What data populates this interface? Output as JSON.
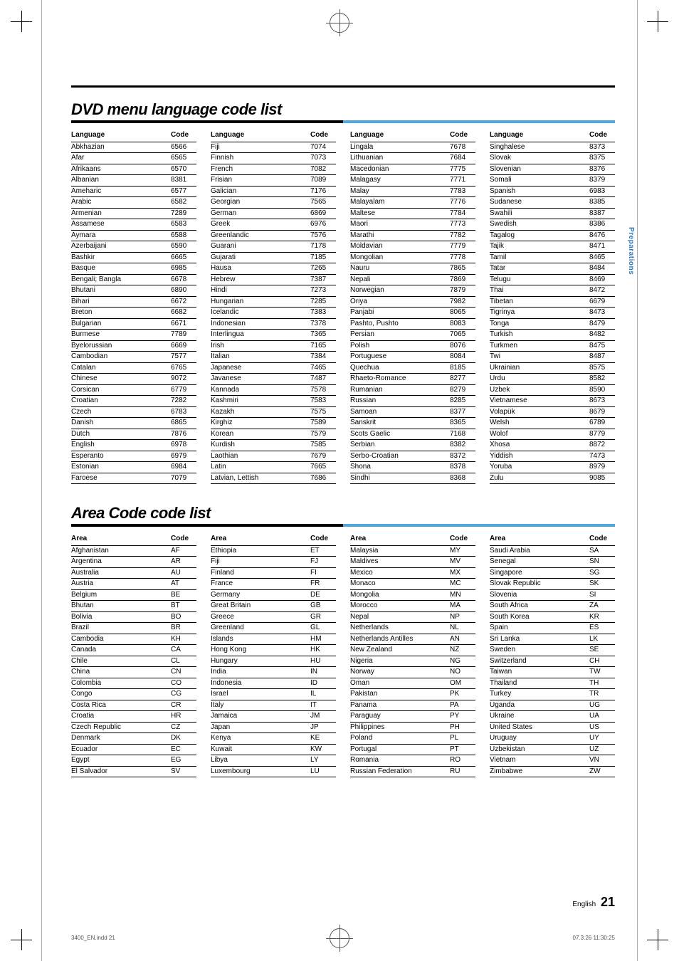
{
  "sideTab": "Preparations",
  "footer": {
    "lang": "English",
    "page": "21"
  },
  "printLeft": "3400_EN.indd   21",
  "printRight": "07.3.26   11:30:25",
  "section1": {
    "title": "DVD menu language code list",
    "headLabels": {
      "left": "Language",
      "right": "Code"
    },
    "cols": [
      [
        [
          "Abkhazian",
          "6566"
        ],
        [
          "Afar",
          "6565"
        ],
        [
          "Afrikaans",
          "6570"
        ],
        [
          "Albanian",
          "8381"
        ],
        [
          "Ameharic",
          "6577"
        ],
        [
          "Arabic",
          "6582"
        ],
        [
          "Armenian",
          "7289"
        ],
        [
          "Assamese",
          "6583"
        ],
        [
          "Aymara",
          "6588"
        ],
        [
          "Azerbaijani",
          "6590"
        ],
        [
          "Bashkir",
          "6665"
        ],
        [
          "Basque",
          "6985"
        ],
        [
          "Bengali; Bangla",
          "6678"
        ],
        [
          "Bhutani",
          "6890"
        ],
        [
          "Bihari",
          "6672"
        ],
        [
          "Breton",
          "6682"
        ],
        [
          "Bulgarian",
          "6671"
        ],
        [
          "Burmese",
          "7789"
        ],
        [
          "Byelorussian",
          "6669"
        ],
        [
          "Cambodian",
          "7577"
        ],
        [
          "Catalan",
          "6765"
        ],
        [
          "Chinese",
          "9072"
        ],
        [
          "Corsican",
          "6779"
        ],
        [
          "Croatian",
          "7282"
        ],
        [
          "Czech",
          "6783"
        ],
        [
          "Danish",
          "6865"
        ],
        [
          "Dutch",
          "7876"
        ],
        [
          "English",
          "6978"
        ],
        [
          "Esperanto",
          "6979"
        ],
        [
          "Estonian",
          "6984"
        ],
        [
          "Faroese",
          "7079"
        ]
      ],
      [
        [
          "Fiji",
          "7074"
        ],
        [
          "Finnish",
          "7073"
        ],
        [
          "French",
          "7082"
        ],
        [
          "Frisian",
          "7089"
        ],
        [
          "Galician",
          "7176"
        ],
        [
          "Georgian",
          "7565"
        ],
        [
          "German",
          "6869"
        ],
        [
          "Greek",
          "6976"
        ],
        [
          "Greenlandic",
          "7576"
        ],
        [
          "Guarani",
          "7178"
        ],
        [
          "Gujarati",
          "7185"
        ],
        [
          "Hausa",
          "7265"
        ],
        [
          "Hebrew",
          "7387"
        ],
        [
          "Hindi",
          "7273"
        ],
        [
          "Hungarian",
          "7285"
        ],
        [
          "Icelandic",
          "7383"
        ],
        [
          "Indonesian",
          "7378"
        ],
        [
          "Interlingua",
          "7365"
        ],
        [
          "Irish",
          "7165"
        ],
        [
          "Italian",
          "7384"
        ],
        [
          "Japanese",
          "7465"
        ],
        [
          "Javanese",
          "7487"
        ],
        [
          "Kannada",
          "7578"
        ],
        [
          "Kashmiri",
          "7583"
        ],
        [
          "Kazakh",
          "7575"
        ],
        [
          "Kirghiz",
          "7589"
        ],
        [
          "Korean",
          "7579"
        ],
        [
          "Kurdish",
          "7585"
        ],
        [
          "Laothian",
          "7679"
        ],
        [
          "Latin",
          "7665"
        ],
        [
          "Latvian, Lettish",
          "7686"
        ]
      ],
      [
        [
          "Lingala",
          "7678"
        ],
        [
          "Lithuanian",
          "7684"
        ],
        [
          "Macedonian",
          "7775"
        ],
        [
          "Malagasy",
          "7771"
        ],
        [
          "Malay",
          "7783"
        ],
        [
          "Malayalam",
          "7776"
        ],
        [
          "Maltese",
          "7784"
        ],
        [
          "Maori",
          "7773"
        ],
        [
          "Marathi",
          "7782"
        ],
        [
          "Moldavian",
          "7779"
        ],
        [
          "Mongolian",
          "7778"
        ],
        [
          "Nauru",
          "7865"
        ],
        [
          "Nepali",
          "7869"
        ],
        [
          "Norwegian",
          "7879"
        ],
        [
          "Oriya",
          "7982"
        ],
        [
          "Panjabi",
          "8065"
        ],
        [
          "Pashto, Pushto",
          "8083"
        ],
        [
          "Persian",
          "7065"
        ],
        [
          "Polish",
          "8076"
        ],
        [
          "Portuguese",
          "8084"
        ],
        [
          "Quechua",
          "8185"
        ],
        [
          "Rhaeto-Romance",
          "8277"
        ],
        [
          "Rumanian",
          "8279"
        ],
        [
          "Russian",
          "8285"
        ],
        [
          "Samoan",
          "8377"
        ],
        [
          "Sanskrit",
          "8365"
        ],
        [
          "Scots Gaelic",
          "7168"
        ],
        [
          "Serbian",
          "8382"
        ],
        [
          "Serbo-Croatian",
          "8372"
        ],
        [
          "Shona",
          "8378"
        ],
        [
          "Sindhi",
          "8368"
        ]
      ],
      [
        [
          "Singhalese",
          "8373"
        ],
        [
          "Slovak",
          "8375"
        ],
        [
          "Slovenian",
          "8376"
        ],
        [
          "Somali",
          "8379"
        ],
        [
          "Spanish",
          "6983"
        ],
        [
          "Sudanese",
          "8385"
        ],
        [
          "Swahili",
          "8387"
        ],
        [
          "Swedish",
          "8386"
        ],
        [
          "Tagalog",
          "8476"
        ],
        [
          "Tajik",
          "8471"
        ],
        [
          "Tamil",
          "8465"
        ],
        [
          "Tatar",
          "8484"
        ],
        [
          "Telugu",
          "8469"
        ],
        [
          "Thai",
          "8472"
        ],
        [
          "Tibetan",
          "6679"
        ],
        [
          "Tigrinya",
          "8473"
        ],
        [
          "Tonga",
          "8479"
        ],
        [
          "Turkish",
          "8482"
        ],
        [
          "Turkmen",
          "8475"
        ],
        [
          "Twi",
          "8487"
        ],
        [
          "Ukrainian",
          "8575"
        ],
        [
          "Urdu",
          "8582"
        ],
        [
          "Uzbek",
          "8590"
        ],
        [
          "Vietnamese",
          "8673"
        ],
        [
          "Volapük",
          "8679"
        ],
        [
          "Welsh",
          "6789"
        ],
        [
          "Wolof",
          "8779"
        ],
        [
          "Xhosa",
          "8872"
        ],
        [
          "Yiddish",
          "7473"
        ],
        [
          "Yoruba",
          "8979"
        ],
        [
          "Zulu",
          "9085"
        ]
      ]
    ]
  },
  "section2": {
    "title": "Area Code code list",
    "headLabels": {
      "left": "Area",
      "right": "Code"
    },
    "cols": [
      [
        [
          "Afghanistan",
          "AF"
        ],
        [
          "Argentina",
          "AR"
        ],
        [
          "Australia",
          "AU"
        ],
        [
          "Austria",
          "AT"
        ],
        [
          "Belgium",
          "BE"
        ],
        [
          "Bhutan",
          "BT"
        ],
        [
          "Bolivia",
          "BO"
        ],
        [
          "Brazil",
          "BR"
        ],
        [
          "Cambodia",
          "KH"
        ],
        [
          "Canada",
          "CA"
        ],
        [
          "Chile",
          "CL"
        ],
        [
          "China",
          "CN"
        ],
        [
          "Colombia",
          "CO"
        ],
        [
          "Congo",
          "CG"
        ],
        [
          "Costa Rica",
          "CR"
        ],
        [
          "Croatia",
          "HR"
        ],
        [
          "Czech Republic",
          "CZ"
        ],
        [
          "Denmark",
          "DK"
        ],
        [
          "Ecuador",
          "EC"
        ],
        [
          "Egypt",
          "EG"
        ],
        [
          "El Salvador",
          "SV"
        ]
      ],
      [
        [
          "Ethiopia",
          "ET"
        ],
        [
          "Fiji",
          "FJ"
        ],
        [
          "Finland",
          "FI"
        ],
        [
          "France",
          "FR"
        ],
        [
          "Germany",
          "DE"
        ],
        [
          "Great Britain",
          "GB"
        ],
        [
          "Greece",
          "GR"
        ],
        [
          "Greenland",
          "GL"
        ],
        [
          "Islands",
          "HM"
        ],
        [
          "Hong Kong",
          "HK"
        ],
        [
          "Hungary",
          "HU"
        ],
        [
          "India",
          "IN"
        ],
        [
          "Indonesia",
          "ID"
        ],
        [
          "Israel",
          "IL"
        ],
        [
          "Italy",
          "IT"
        ],
        [
          "Jamaica",
          "JM"
        ],
        [
          "Japan",
          "JP"
        ],
        [
          "Kenya",
          "KE"
        ],
        [
          "Kuwait",
          "KW"
        ],
        [
          "Libya",
          "LY"
        ],
        [
          "Luxembourg",
          "LU"
        ]
      ],
      [
        [
          "Malaysia",
          "MY"
        ],
        [
          "Maldives",
          "MV"
        ],
        [
          "Mexico",
          "MX"
        ],
        [
          "Monaco",
          "MC"
        ],
        [
          "Mongolia",
          "MN"
        ],
        [
          "Morocco",
          "MA"
        ],
        [
          "Nepal",
          "NP"
        ],
        [
          "Netherlands",
          "NL"
        ],
        [
          "Netherlands Antilles",
          "AN"
        ],
        [
          "New Zealand",
          "NZ"
        ],
        [
          "Nigeria",
          "NG"
        ],
        [
          "Norway",
          "NO"
        ],
        [
          "Oman",
          "OM"
        ],
        [
          "Pakistan",
          "PK"
        ],
        [
          "Panama",
          "PA"
        ],
        [
          "Paraguay",
          "PY"
        ],
        [
          "Philippines",
          "PH"
        ],
        [
          "Poland",
          "PL"
        ],
        [
          "Portugal",
          "PT"
        ],
        [
          "Romania",
          "RO"
        ],
        [
          "Russian Federation",
          "RU"
        ]
      ],
      [
        [
          "Saudi Arabia",
          "SA"
        ],
        [
          "Senegal",
          "SN"
        ],
        [
          "Singapore",
          "SG"
        ],
        [
          "Slovak Republic",
          "SK"
        ],
        [
          "Slovenia",
          "SI"
        ],
        [
          "South Africa",
          "ZA"
        ],
        [
          "South Korea",
          "KR"
        ],
        [
          "Spain",
          "ES"
        ],
        [
          "Sri Lanka",
          "LK"
        ],
        [
          "Sweden",
          "SE"
        ],
        [
          "Switzerland",
          "CH"
        ],
        [
          "Taiwan",
          "TW"
        ],
        [
          "Thailand",
          "TH"
        ],
        [
          "Turkey",
          "TR"
        ],
        [
          "Uganda",
          "UG"
        ],
        [
          "Ukraine",
          "UA"
        ],
        [
          "United States",
          "US"
        ],
        [
          "Uruguay",
          "UY"
        ],
        [
          "Uzbekistan",
          "UZ"
        ],
        [
          "Vietnam",
          "VN"
        ],
        [
          "Zimbabwe",
          "ZW"
        ]
      ]
    ]
  }
}
